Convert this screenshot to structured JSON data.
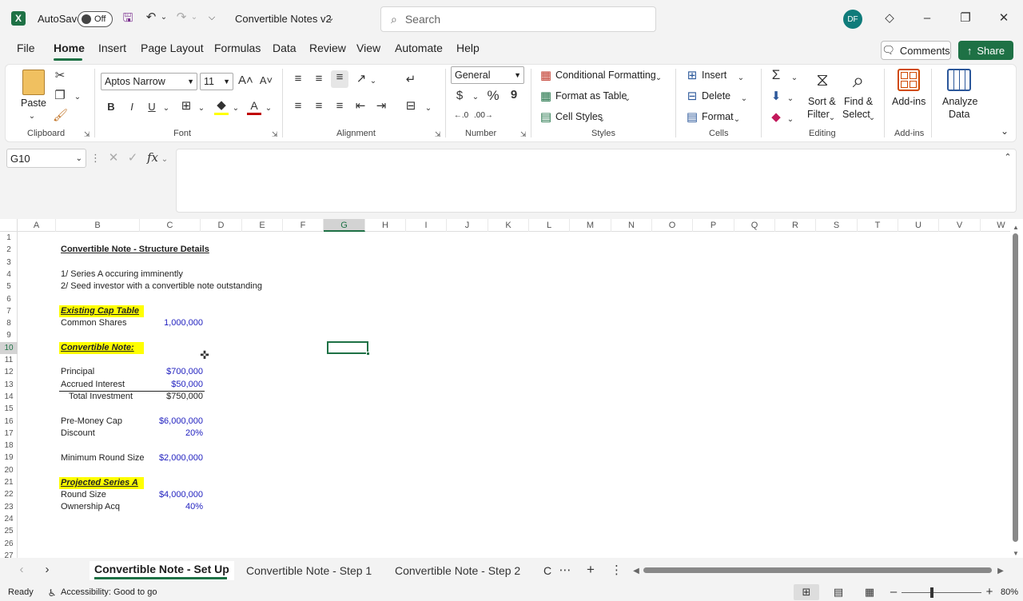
{
  "titlebar": {
    "autosave_label": "AutoSave",
    "autosave_state": "Off",
    "doc_title": "Convertible Notes v2",
    "search_placeholder": "Search",
    "avatar_initials": "DF"
  },
  "menu": {
    "items": [
      "File",
      "Home",
      "Insert",
      "Page Layout",
      "Formulas",
      "Data",
      "Review",
      "View",
      "Automate",
      "Help"
    ],
    "active": "Home",
    "comments_label": "Comments",
    "share_label": "Share"
  },
  "ribbon": {
    "clipboard": {
      "paste": "Paste",
      "label": "Clipboard"
    },
    "font": {
      "name": "Aptos Narrow",
      "size": "11",
      "label": "Font",
      "bold": "B",
      "italic": "I",
      "underline": "U"
    },
    "alignment": {
      "label": "Alignment"
    },
    "number": {
      "format": "General",
      "label": "Number",
      "currency": "$",
      "percent": "%",
      "comma": "9"
    },
    "styles": {
      "conditional": "Conditional Formatting",
      "format_table": "Format as Table",
      "cell_styles": "Cell Styles",
      "label": "Styles"
    },
    "cells": {
      "insert": "Insert",
      "delete": "Delete",
      "format": "Format",
      "label": "Cells"
    },
    "editing": {
      "sort1": "Sort &",
      "sort2": "Filter",
      "find1": "Find &",
      "find2": "Select",
      "label": "Editing"
    },
    "addins": {
      "addins": "Add-ins",
      "label": "Add-ins"
    },
    "analyze": {
      "line1": "Analyze",
      "line2": "Data"
    }
  },
  "formula_bar": {
    "name_box": "G10",
    "fx": "fx",
    "value": ""
  },
  "grid": {
    "columns": [
      "A",
      "B",
      "C",
      "D",
      "E",
      "F",
      "G",
      "H",
      "I",
      "J",
      "K",
      "L",
      "M",
      "N",
      "O",
      "P",
      "Q",
      "R",
      "S",
      "T",
      "U",
      "V",
      "W"
    ],
    "rows": [
      "1",
      "2",
      "3",
      "4",
      "5",
      "6",
      "7",
      "8",
      "9",
      "10",
      "11",
      "12",
      "13",
      "14",
      "15",
      "16",
      "17",
      "18",
      "19",
      "20",
      "21",
      "22",
      "23",
      "24",
      "25",
      "26",
      "27"
    ],
    "selected_col": "G",
    "selected_row": "10",
    "cells": {
      "b2": "Convertible Note - Structure Details",
      "b4": "1/ Series A occuring imminently",
      "b5": "2/ Seed investor with a convertible note outstanding",
      "b7": "Existing Cap Table",
      "b8": "Common Shares",
      "c8": "1,000,000",
      "b10": "Convertible Note:",
      "b12": "Principal",
      "c12": "$700,000",
      "b13": "Accrued Interest",
      "c13": "$50,000",
      "b14": "Total Investment",
      "c14": "$750,000",
      "b16": "Pre-Money Cap",
      "c16": "$6,000,000",
      "b17": "Discount",
      "c17": "20%",
      "b19": "Minimum Round Size",
      "c19": "$2,000,000",
      "b21": "Projected Series A",
      "b22": "Round Size",
      "c22": "$4,000,000",
      "b23": "Ownership Acq",
      "c23": "40%"
    }
  },
  "sheets": {
    "tabs": [
      "Convertible Note - Set Up",
      "Convertible Note - Step 1",
      "Convertible Note - Step 2",
      "C"
    ],
    "active": "Convertible Note - Set Up"
  },
  "status": {
    "ready": "Ready",
    "accessibility": "Accessibility: Good to go",
    "zoom": "80%"
  },
  "colors": {
    "accent": "#1e7145",
    "highlight": "#ffff00",
    "input_blue": "#1f1fbf"
  }
}
